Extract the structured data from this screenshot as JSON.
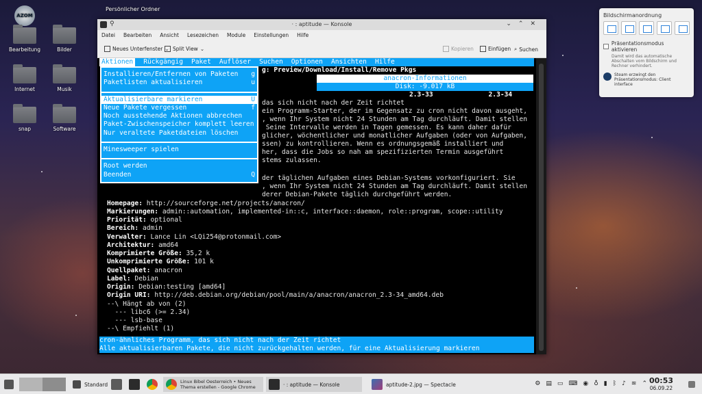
{
  "desktop": {
    "folder_top": "Persönlicher Ordner",
    "icons": [
      {
        "label": "Bearbeitung"
      },
      {
        "label": "Bilder"
      },
      {
        "label": "Internet"
      },
      {
        "label": "Musik"
      },
      {
        "label": "snap"
      },
      {
        "label": "Software"
      }
    ],
    "logo_text": "AZOM"
  },
  "window": {
    "title": "· : aptitude — Konsole",
    "menu": [
      "Datei",
      "Bearbeiten",
      "Ansicht",
      "Lesezeichen",
      "Module",
      "Einstellungen",
      "Hilfe"
    ],
    "toolbar": {
      "new_tab": "Neues Unterfenster",
      "split": "Split View",
      "copy": "Kopieren",
      "paste": "Einfügen",
      "search": "Suchen"
    }
  },
  "terminal": {
    "menu": [
      "Aktionen",
      "Rückgängig",
      "Paket",
      "Auflöser",
      "Suchen",
      "Optionen",
      "Ansichten",
      "Hilfe"
    ],
    "subtitle": "g: Preview/Download/Install/Remove Pkgs",
    "info_title": "anacron-Informationen",
    "disk": "Disk: -9.017 kB",
    "versions": "2.3-33              2.3-34",
    "dropdown": [
      {
        "label": "Installieren/Entfernen von Paketen",
        "key": "g"
      },
      {
        "label": "Paketlisten aktualisieren",
        "key": "u"
      },
      {
        "sep": true
      },
      {
        "label": "Aktualisierbare markieren",
        "key": "U",
        "selected": true
      },
      {
        "label": "Neue Pakete vergessen",
        "key": "f"
      },
      {
        "label": "Noch ausstehende Aktionen abbrechen",
        "key": ""
      },
      {
        "label": "Paket-Zwischenspeicher komplett leeren",
        "key": ""
      },
      {
        "label": "Nur veraltete Paketdateien löschen",
        "key": ""
      },
      {
        "sep": true
      },
      {
        "label": "Minesweeper spielen",
        "key": ""
      },
      {
        "sep": true
      },
      {
        "label": "Root werden",
        "key": ""
      },
      {
        "label": "Beenden",
        "key": "Q"
      }
    ],
    "desc_lines": [
      "das sich nicht nach der Zeit richtet",
      "ein Programm-Starter, der im Gegensatz zu cron nicht davon ausgeht,",
      ", wenn Ihr System nicht 24 Stunden am Tag durchläuft. Damit stellen",
      " Seine Intervalle werden in Tagen gemessen. Es kann daher dafür",
      "glicher, wöchentlicher und monatlicher Aufgaben (oder von Aufgaben,",
      "ssen) zu kontrollieren. Wenn es ordnungsgemäß installiert und",
      "her, dass die Jobs so nah am spezifizierten Termin ausgeführt",
      "stems zulassen."
    ],
    "desc_lines2": [
      "der täglichen Aufgaben eines Debian-Systems vorkonfiguriert. Sie",
      ", wenn Ihr System nicht 24 Stunden am Tag durchläuft. Damit stellen",
      "derer Debian-Pakete täglich durchgeführt werden."
    ],
    "fields": [
      {
        "k": "Homepage:",
        "v": " http://sourceforge.net/projects/anacron/"
      },
      {
        "k": "Markierungen:",
        "v": " admin::automation, implemented-in::c, interface::daemon, role::program, scope::utility"
      },
      {
        "k": "Priorität:",
        "v": " optional"
      },
      {
        "k": "Bereich:",
        "v": " admin"
      },
      {
        "k": "Verwalter:",
        "v": " Lance Lin <LQi254@protonmail.com>"
      },
      {
        "k": "Architektur:",
        "v": " amd64"
      },
      {
        "k": "Komprimierte Größe:",
        "v": " 35,2 k"
      },
      {
        "k": "Unkomprimierte Größe:",
        "v": " 101 k"
      },
      {
        "k": "Quellpaket:",
        "v": " anacron"
      },
      {
        "k": "Label:",
        "v": " Debian"
      },
      {
        "k": "Origin:",
        "v": " Debian:testing [amd64]"
      },
      {
        "k": "Origin URI:",
        "v": " http://deb.debian.org/debian/pool/main/a/anacron/anacron_2.3-34_amd64.deb"
      }
    ],
    "tree": [
      "--\\ Hängt ab von (2)",
      "  --- libc6 (>= 2.34)",
      "  --- lsb-base",
      "--\\ Empfiehlt (1)",
      "  --- cron | cron-daemon"
    ],
    "status1": "cron-ähnliches Programm, das sich nicht nach der Zeit richtet",
    "status2": "Alle aktualisierbaren Pakete, die nicht zurückgehalten werden, für eine Aktualisierung markieren"
  },
  "notification": {
    "title": "Bildschirmanordnung",
    "checkbox": "Präsentationsmodus aktivieren",
    "desc": "Damit wird das automatische Abschalten vom Bildschirm und Rechner verhindert.",
    "steam": "Steam erzwingt den Präsentationsmodus: Client interface"
  },
  "taskbar": {
    "standard": "Standard",
    "chrome_task": "Linux Bibel Oesterreich • Neues Thema erstellen - Google Chrome",
    "konsole_task": "· : aptitude — Konsole",
    "spectacle_task": "aptitude-2.jpg — Spectacle",
    "time": "00:53",
    "date": "06.09.22"
  }
}
